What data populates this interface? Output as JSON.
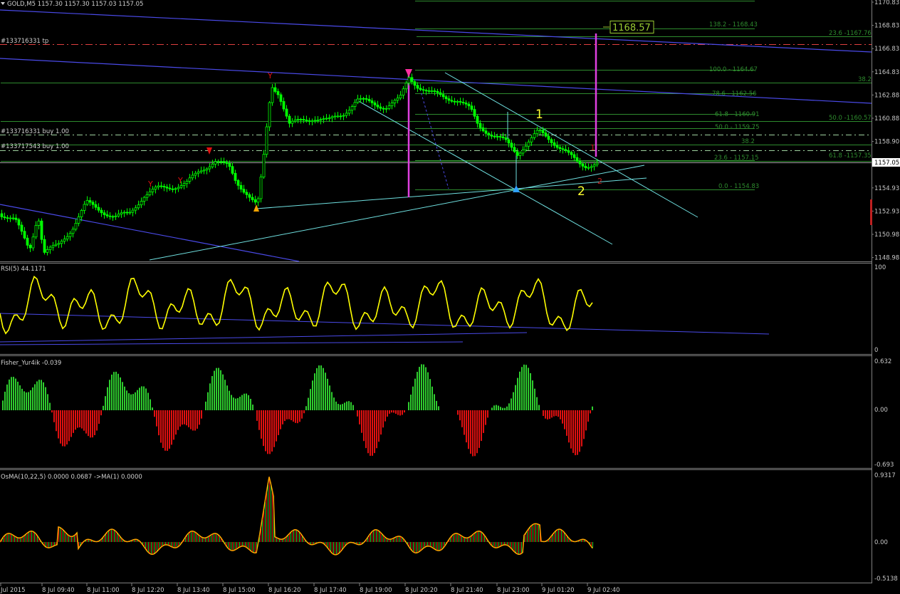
{
  "header": {
    "symbol_text": "GOLD,M5  1157.30 1157.30 1157.03 1157.05"
  },
  "colors": {
    "background": "#000000",
    "bull_candle": "#00ff00",
    "bear_candle": "#00ff00",
    "price_line": "#c0c0c0",
    "rsi_line": "#ffff00",
    "fisher_up": "#2ecc2e",
    "fisher_down": "#e01010",
    "osma_line": "#ffa500",
    "fib_line": "#2e8b2e",
    "trend_cyan": "#6fe0e0",
    "trend_blue": "#4a4ae8",
    "magenta": "#e040e0",
    "order_dash": "#b0e0b0",
    "tp_dash": "#e04040"
  },
  "price_panel": {
    "y_ticks": [
      "1170.83",
      "1168.83",
      "1166.83",
      "1164.83",
      "1162.88",
      "1160.88",
      "1158.90",
      "1156.90",
      "1154.93",
      "1152.93",
      "1150.98",
      "1148.98"
    ],
    "current_price": "1157.05",
    "big_price_label": "1168.57",
    "order_labels": [
      {
        "text": "#133716331 tp",
        "id": "tp"
      },
      {
        "text": "#133716331 buy  1.00",
        "id": "buy1"
      },
      {
        "text": "#133717543 buy  1.00",
        "id": "buy2"
      }
    ],
    "fib_labels_right": [
      "23.6 -1167.76",
      "38.2",
      "50.0 -1160.57",
      "38.2",
      "61.8 -1157.35"
    ],
    "fib_labels_mid": [
      "138.2 - 1168.43",
      "100.0 - 1164.67",
      "78.6 - 1162.56",
      "61.8 - 1160.91",
      "50.0 - 1159.75",
      "23.6 - 1157.15",
      "0.0 - 1154.83"
    ],
    "wave_labels": [
      "1",
      "2"
    ],
    "red_labels": [
      "1",
      "2"
    ]
  },
  "rsi_panel": {
    "title": "RSI(5) 44.1171",
    "y_ticks": [
      "100",
      "0"
    ]
  },
  "fisher_panel": {
    "title": "Fisher_Yur4ik -0.039",
    "y_ticks": [
      "0.632",
      "0.00",
      "-0.693"
    ]
  },
  "osma_panel": {
    "title": "OsMA(10,22,5) 0.0000 0.0687  ->MA(1) 0.0000",
    "y_ticks": [
      "0.9317",
      "0.00",
      "-0.5138"
    ]
  },
  "time_axis": [
    "Jul 2015",
    "8 Jul 09:40",
    "8 Jul 11:00",
    "8 Jul 12:20",
    "8 Jul 13:40",
    "8 Jul 15:00",
    "8 Jul 16:20",
    "8 Jul 17:40",
    "8 Jul 19:00",
    "8 Jul 20:20",
    "8 Jul 21:40",
    "8 Jul 23:00",
    "9 Jul 01:20",
    "9 Jul 02:40"
  ]
}
